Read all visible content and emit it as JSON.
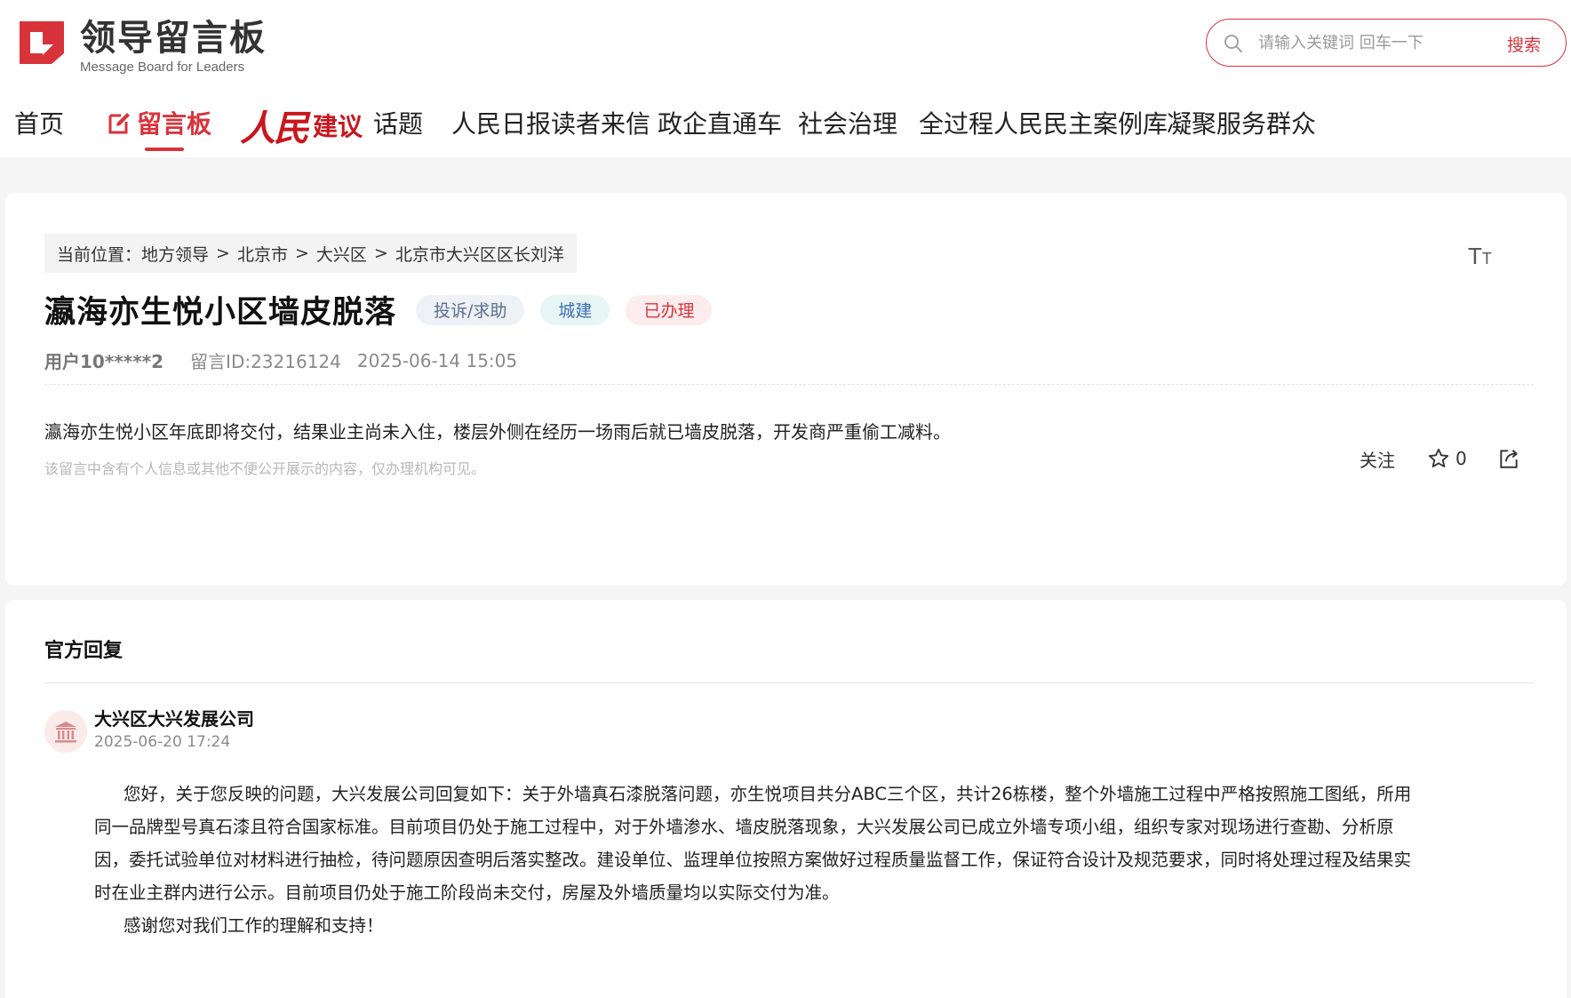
{
  "header": {
    "logo_cn": "领导留言板",
    "logo_en": "Message Board for Leaders",
    "search": {
      "placeholder": "请输入关键词 回车一下",
      "button_label": "搜索"
    }
  },
  "nav": {
    "home": "首页",
    "message_board": "留言板",
    "rmjy_a": "人民",
    "rmjy_b": "建议",
    "topics": "话题",
    "letters": "人民日报读者来信",
    "gov_direct": "政企直通车",
    "governance": "社会治理",
    "democracy_cases": "全过程人民民主案例库",
    "serve_masses": "凝聚服务群众"
  },
  "breadcrumb": {
    "label": "当前位置：",
    "items": [
      "地方领导",
      "北京市",
      "大兴区",
      "北京市大兴区区长刘洋"
    ],
    "sep": ">"
  },
  "font_toggle": {
    "big": "T",
    "small": "T"
  },
  "message": {
    "title": "瀛海亦生悦小区墙皮脱落",
    "tags": {
      "type": "投诉/求助",
      "category": "城建",
      "status": "已办理"
    },
    "user": "用户10*****2",
    "message_id": "留言ID:23216124",
    "time": "2025-06-14 15:05",
    "content": "瀛海亦生悦小区年底即将交付，结果业主尚未入住，楼层外侧在经历一场雨后就已墙皮脱落，开发商严重偷工减料。",
    "privacy_note": "该留言中含有个人信息或其他不便公开展示的内容，仅办理机构可见。",
    "follow_label": "关注",
    "like_count": "0"
  },
  "reply": {
    "heading": "官方回复",
    "org_name": "大兴区大兴发展公司",
    "time": "2025-06-20 17:24",
    "lines": [
      "您好，关于您反映的问题，大兴发展公司回复如下：关于外墙真石漆脱落问题，亦生悦项目共分ABC三个区，共计26栋楼，整个外墙施工过程中严格按照施工图纸，所用",
      "同一品牌型号真石漆且符合国家标准。目前项目仍处于施工过程中，对于外墙渗水、墙皮脱落现象，大兴发展公司已成立外墙专项小组，组织专家对现场进行查勘、分析原",
      "因，委托试验单位对材料进行抽检，待问题原因查明后落实整改。建设单位、监理单位按照方案做好过程质量监督工作，保证符合设计及规范要求，同时将处理过程及结果实",
      "时在业主群内进行公示。目前项目仍处于施工阶段尚未交付，房屋及外墙质量均以实际交付为准。",
      "感谢您对我们工作的理解和支持！"
    ]
  },
  "colors": {
    "brand_red": "#d8333b",
    "background": "#f5f5f6"
  },
  "icons": [
    "logo-mark-icon",
    "search-icon",
    "edit-icon",
    "font-size-icon",
    "star-icon",
    "share-icon",
    "government-building-icon"
  ]
}
